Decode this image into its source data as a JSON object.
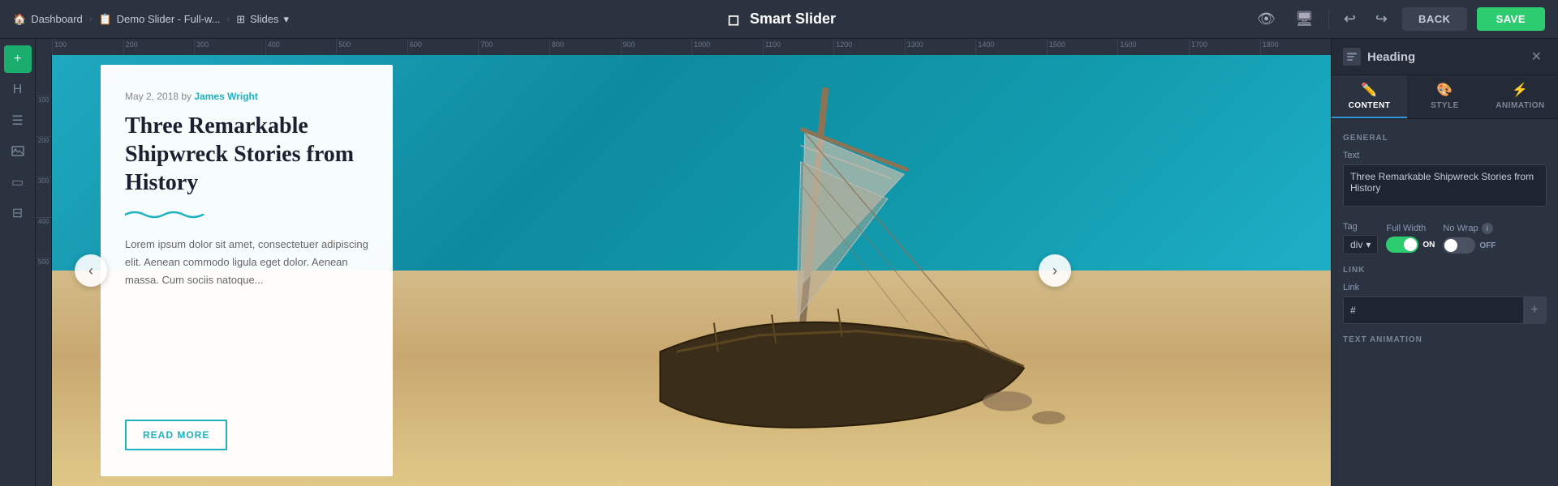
{
  "app": {
    "brand": "Smart Slider",
    "brand_icon": "◻"
  },
  "nav": {
    "dashboard_label": "Dashboard",
    "slider_label": "Demo Slider - Full-w...",
    "slides_label": "Slides",
    "back_button": "BACK",
    "save_button": "SAVE"
  },
  "ruler": {
    "marks": [
      "100",
      "200",
      "300",
      "400",
      "500",
      "600",
      "700",
      "800",
      "900",
      "1000",
      "1100",
      "1200",
      "1300",
      "1400",
      "1500",
      "1600",
      "1700",
      "1800"
    ]
  },
  "slide": {
    "card": {
      "meta": "May 2, 2018 by",
      "author": "James Wright",
      "title": "Three Remarkable Shipwreck Stories from History",
      "excerpt": "Lorem ipsum dolor sit amet, consectetuer adipiscing elit. Aenean commodo ligula eget dolor. Aenean massa. Cum sociis natoque...",
      "read_more": "READ MORE"
    }
  },
  "panel": {
    "title": "Heading",
    "tabs": [
      {
        "id": "content",
        "label": "CONTENT",
        "active": true
      },
      {
        "id": "style",
        "label": "STYLE",
        "active": false
      },
      {
        "id": "animation",
        "label": "ANIMATION",
        "active": false
      }
    ],
    "general_label": "GENERAL",
    "text_label": "Text",
    "text_value": "Three Remarkable Shipwreck Stories from History",
    "tag_label": "Tag",
    "tag_value": "div",
    "full_width_label": "Full Width",
    "full_width_on": true,
    "full_width_toggle_label": "ON",
    "no_wrap_label": "No Wrap",
    "no_wrap_on": false,
    "no_wrap_toggle_label": "OFF",
    "link_section_label": "LINK",
    "link_label": "Link",
    "link_value": "#",
    "link_placeholder": "#",
    "text_animation_label": "TEXT ANIMATION"
  },
  "sidebar": {
    "items": [
      {
        "id": "add",
        "icon": "+",
        "active": true
      },
      {
        "id": "heading",
        "icon": "H",
        "active": false
      },
      {
        "id": "menu",
        "icon": "☰",
        "active": false
      },
      {
        "id": "image",
        "icon": "🖼",
        "active": false
      },
      {
        "id": "widget",
        "icon": "▭",
        "active": false
      },
      {
        "id": "layout",
        "icon": "⊟",
        "active": false
      }
    ]
  }
}
